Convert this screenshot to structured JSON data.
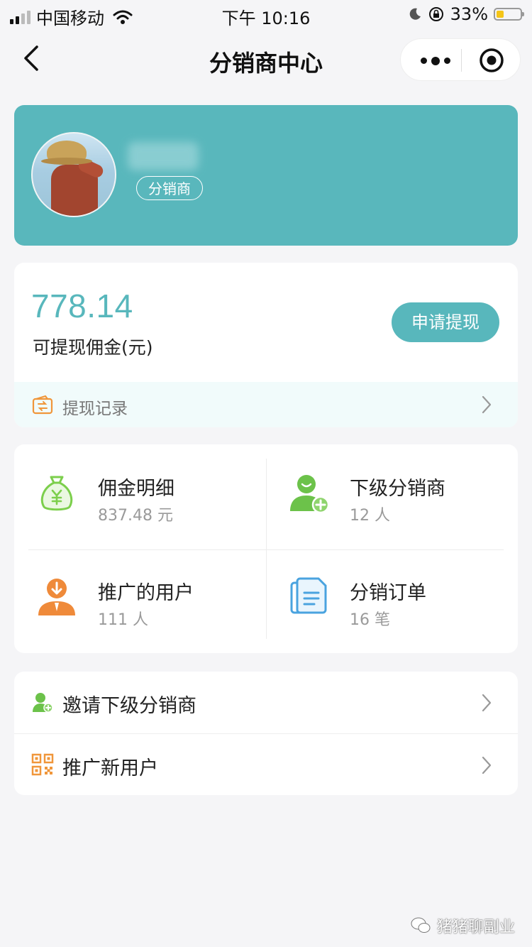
{
  "status_bar": {
    "carrier": "中国移动",
    "time": "下午 10:16",
    "battery_percent": "33%",
    "battery_color": "#f5c518"
  },
  "nav": {
    "title": "分销商中心",
    "back_icon": "chevron-left-icon",
    "more_icon": "more-dots-icon",
    "close_icon": "target-icon"
  },
  "profile": {
    "role_badge": "分销商",
    "card_color": "#59b7bc"
  },
  "commission": {
    "amount": "778.14",
    "label": "可提现佣金(元)",
    "withdraw_button": "申请提现",
    "record_label": "提现记录",
    "accent_color": "#58b7bc"
  },
  "grid": {
    "items": [
      {
        "title": "佣金明细",
        "sub": "837.48 元",
        "icon": "money-bag-icon"
      },
      {
        "title": "下级分销商",
        "sub": "12 人",
        "icon": "add-user-icon"
      },
      {
        "title": "推广的用户",
        "sub": "111 人",
        "icon": "user-download-icon"
      },
      {
        "title": "分销订单",
        "sub": "16 笔",
        "icon": "document-icon"
      }
    ]
  },
  "menu": {
    "items": [
      {
        "label": "邀请下级分销商",
        "icon": "invite-user-icon"
      },
      {
        "label": "推广新用户",
        "icon": "qr-code-icon"
      }
    ]
  },
  "watermark": "猪猪聊副业"
}
